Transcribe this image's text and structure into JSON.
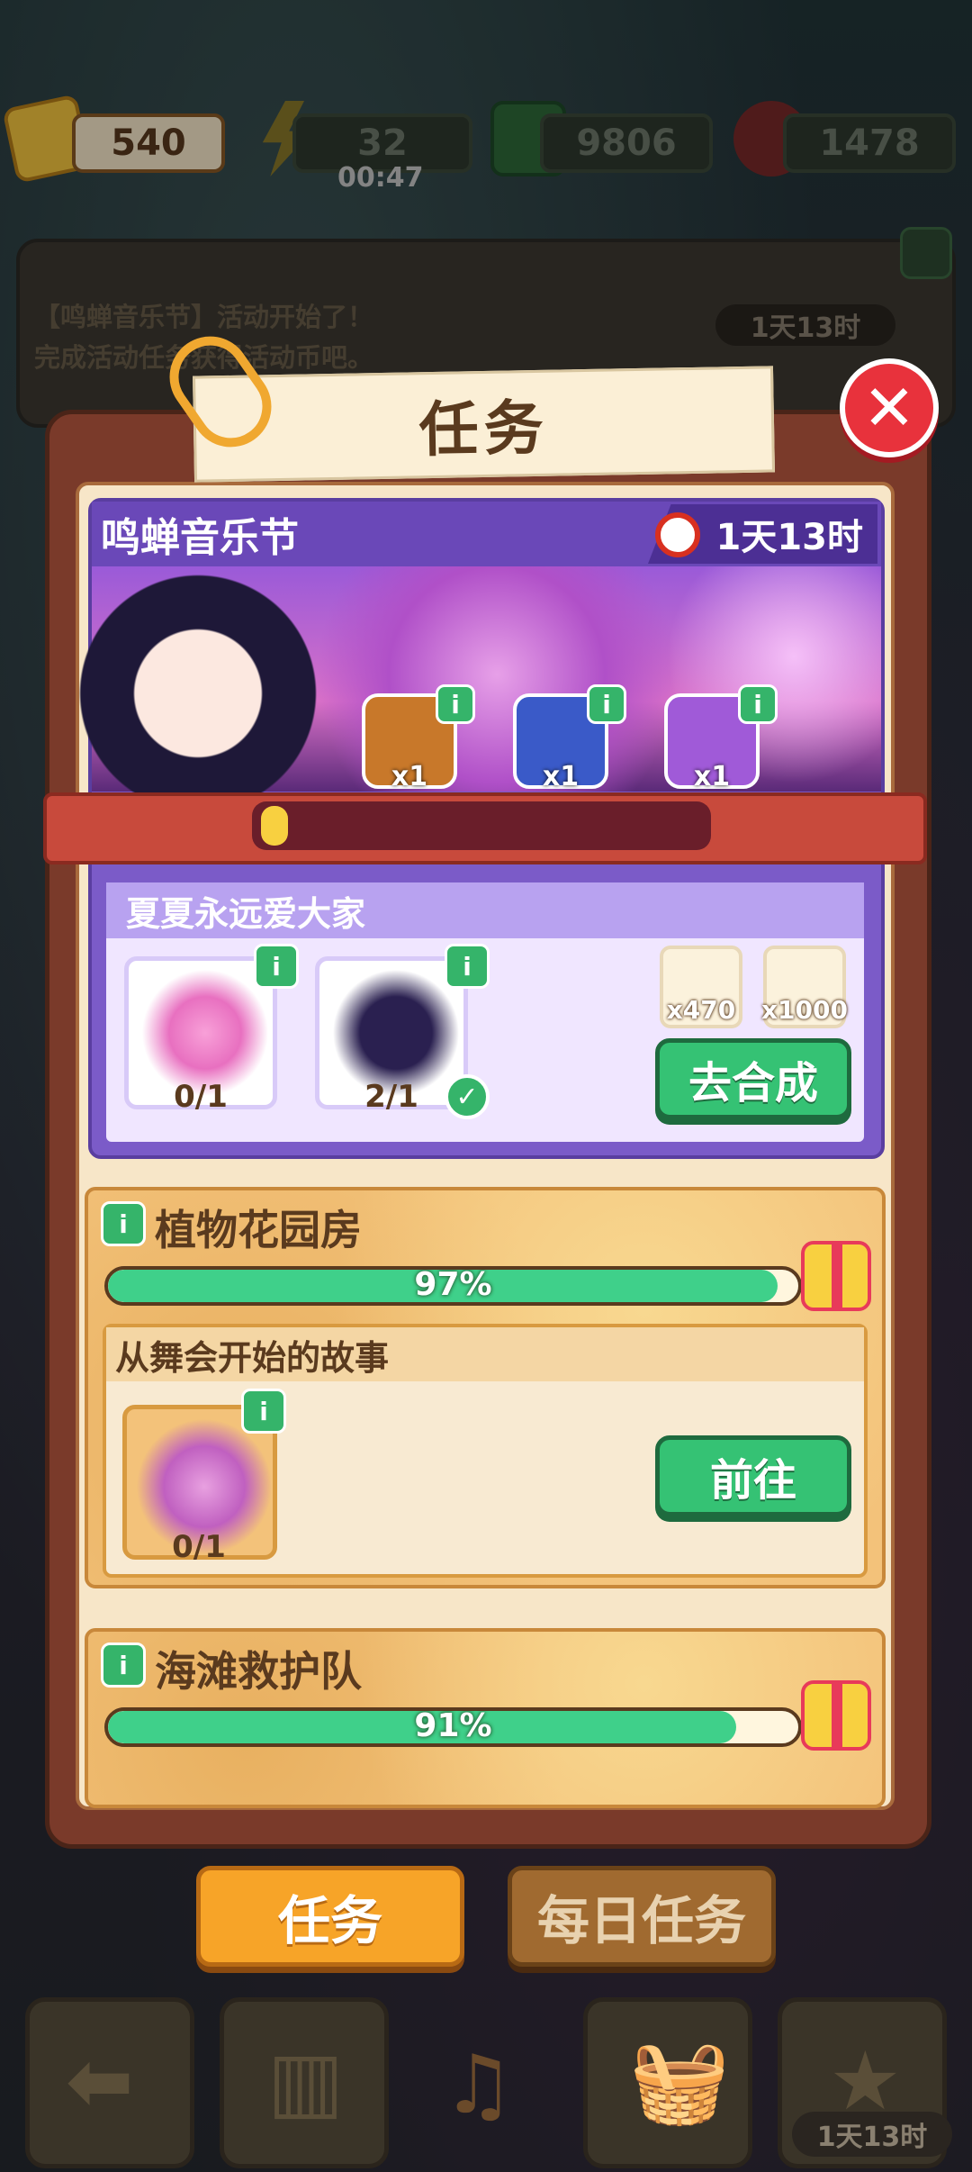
{
  "currency": {
    "tickets": "540",
    "energy": "32",
    "energy_timer": "00:47",
    "cash": "9806",
    "gems": "1478"
  },
  "bg_event": {
    "line1": "【鸣蝉音乐节】活动开始了！",
    "line2": "完成活动任务获得活动币吧。",
    "time": "1天13时"
  },
  "modal": {
    "title": "任务",
    "close_icon": "close-icon"
  },
  "event": {
    "name": "鸣蝉音乐节",
    "time_left": "1天13时",
    "progress": 0.03,
    "chests": [
      {
        "name": "treasure-chest-orange",
        "count": "x1"
      },
      {
        "name": "treasure-chest-blue",
        "count": "x1"
      },
      {
        "name": "treasure-chest-purple",
        "count": "x1"
      }
    ],
    "task": {
      "title": "夏夏永远爱大家",
      "items": [
        {
          "name": "flower-bouquet",
          "count": "0/1"
        },
        {
          "name": "singer-figure",
          "count": "2/1"
        }
      ],
      "rewards": [
        {
          "icon": "ticket-icon",
          "label": "x470"
        },
        {
          "icon": "cash-icon",
          "label": "x1000"
        }
      ],
      "button": "去合成"
    }
  },
  "sections": [
    {
      "title": "植物花园房",
      "percent_label": "97%",
      "percent": 97,
      "task": {
        "title": "从舞会开始的故事",
        "item_count": "0/1",
        "button": "前往"
      }
    },
    {
      "title": "海滩救护队",
      "percent_label": "91%",
      "percent": 91
    }
  ],
  "tabs": [
    "任务",
    "每日任务"
  ],
  "bottom_timer": "1天13时",
  "colors": {
    "green": "#35c274",
    "purple": "#7b5bc8",
    "orange": "#f7a428",
    "red": "#e8323c"
  }
}
